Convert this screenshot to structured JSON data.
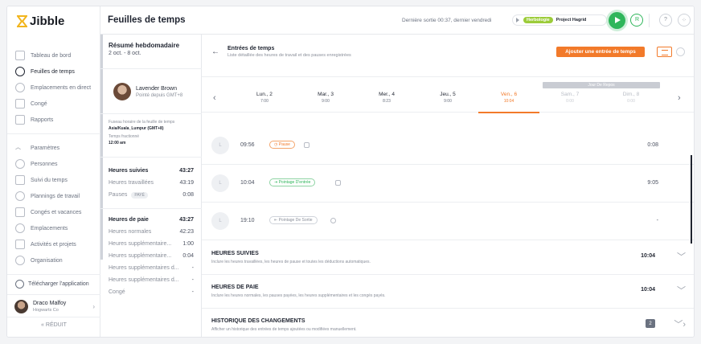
{
  "app": {
    "logo_text": "Jibble"
  },
  "sidebar": {
    "items": [
      {
        "label": "Tableau de bord",
        "icon": "dashboard-icon"
      },
      {
        "label": "Feuilles de temps",
        "icon": "clock-icon",
        "active": true
      },
      {
        "label": "Emplacements en direct",
        "icon": "location-icon"
      },
      {
        "label": "Congé",
        "icon": "calendar-icon"
      },
      {
        "label": "Rapports",
        "icon": "report-icon"
      }
    ],
    "settings_items": [
      {
        "label": "Paramètres",
        "icon": "chevron-up-icon"
      },
      {
        "label": "Personnes",
        "icon": "people-icon"
      },
      {
        "label": "Suivi du temps",
        "icon": "time-tracking-icon"
      },
      {
        "label": "Plannings de travail",
        "icon": "schedule-icon"
      },
      {
        "label": "Congés et vacances",
        "icon": "holiday-icon"
      },
      {
        "label": "Emplacements",
        "icon": "pin-icon"
      },
      {
        "label": "Activités et projets",
        "icon": "tag-icon"
      },
      {
        "label": "Organisation",
        "icon": "gear-icon"
      }
    ],
    "download_label": "Télécharger l'application",
    "user_name": "Draco Malfoy",
    "user_org": "Hogwarts Co",
    "reduce_label": "« RÉDUIT"
  },
  "header": {
    "title": "Feuilles de temps",
    "last_out": "Dernière sortie 00:37, dernier vendredi",
    "activity_tag": "Herbologie",
    "project": "Project Hagrid",
    "user_initial": "R",
    "help_icon": "question-icon",
    "apps_icon": "grid-icon"
  },
  "summary": {
    "title": "Résumé hebdomadaire",
    "date_range": "2 oct. - 8 oct.",
    "employee_name": "Lavender Brown",
    "employee_timezone": "Pointé depuis GMT+8",
    "tz_label": "Fuseau horaire de la feuille de temps",
    "tz_value": "Asia/Kuala_Lumpur (GMT+8)",
    "split_label": "Temps fractionné",
    "split_value": "12:00 am",
    "tracked": [
      {
        "label": "Heures suivies",
        "value": "43:27",
        "bold": true
      },
      {
        "label": "Heures travaillées",
        "value": "43:19"
      },
      {
        "label": "Pauses",
        "badge": "PAYÉ",
        "value": "0:08"
      }
    ],
    "payroll": [
      {
        "label": "Heures de paie",
        "value": "43:27",
        "bold": true
      },
      {
        "label": "Heures normales",
        "value": "42:23"
      },
      {
        "label": "Heures supplémentaire...",
        "value": "1:00"
      },
      {
        "label": "Heures supplémentaire...",
        "value": "0:04"
      },
      {
        "label": "Heures supplémentaires d...",
        "value": "-"
      },
      {
        "label": "Heures supplémentaires d...",
        "value": "-"
      },
      {
        "label": "Congé",
        "value": "-"
      }
    ]
  },
  "main": {
    "title": "Entrées de temps",
    "subtitle": "Liste détaillée des heures de travail et des pauses enregistrées",
    "add_button": "Ajouter une entrée de temps",
    "rest_day_label": "Jour De Repos",
    "days": [
      {
        "label": "Lun., 2",
        "hours": "7:00"
      },
      {
        "label": "Mar., 3",
        "hours": "9:00"
      },
      {
        "label": "Mer., 4",
        "hours": "8:23"
      },
      {
        "label": "Jeu., 5",
        "hours": "9:00"
      },
      {
        "label": "Ven., 6",
        "hours": "10:04",
        "active": true
      },
      {
        "label": "Sam., 7",
        "hours": "0:00",
        "weekend": true
      },
      {
        "label": "Dim., 8",
        "hours": "0:00",
        "weekend": true
      }
    ],
    "entries": [
      {
        "initial": "L",
        "time": "09:56",
        "type": "Pause",
        "color": "orange",
        "duration": "0:08"
      },
      {
        "initial": "L",
        "time": "10:04",
        "type": "Pointage D'entrée",
        "color": "green",
        "duration": "9:05"
      },
      {
        "initial": "L",
        "time": "19:10",
        "type": "Pointage De Sortie",
        "color": "gray",
        "duration": "-"
      }
    ],
    "sections": [
      {
        "title": "HEURES SUIVIES",
        "desc": "Inclure les heures travaillées, les heures de pause et toutes les déductions automatiques.",
        "value": "10:04"
      },
      {
        "title": "HEURES DE PAIE",
        "desc": "Inclure les heures normales, les pauses payées, les heures supplémentaires et les congés payés.",
        "value": "10:04"
      },
      {
        "title": "HISTORIQUE DES CHANGEMENTS",
        "desc": "Afficher un historique des entrées de temps ajoutées ou modifiées manuellement.",
        "count": "2"
      }
    ]
  },
  "colors": {
    "accent": "#f27a2a",
    "green": "#2fb65b",
    "herbology": "#9ccc3a"
  }
}
